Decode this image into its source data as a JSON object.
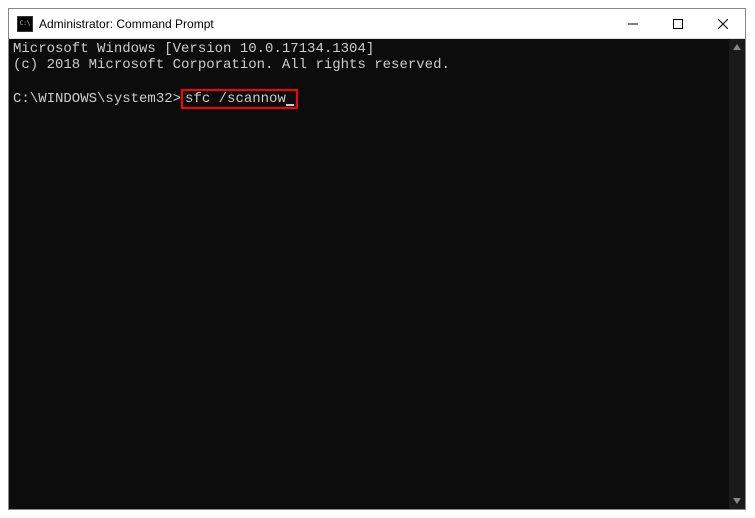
{
  "window": {
    "title": "Administrator: Command Prompt",
    "icon_label": "cmd-icon"
  },
  "terminal": {
    "line1": "Microsoft Windows [Version 10.0.17134.1304]",
    "line2": "(c) 2018 Microsoft Corporation. All rights reserved.",
    "blank": "",
    "prompt": "C:\\WINDOWS\\system32>",
    "command": "sfc /scannow"
  }
}
